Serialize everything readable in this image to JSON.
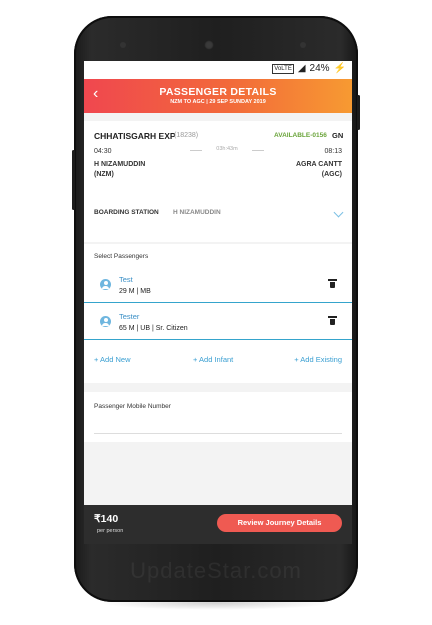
{
  "status_bar": {
    "network": "VoLTE",
    "battery": "24%"
  },
  "header": {
    "title": "PASSENGER DETAILS",
    "subtitle": "NZM TO AGC | 29 SEP SUNDAY 2019"
  },
  "train": {
    "name": "CHHATISGARH EXP",
    "number": "(18238)",
    "availability": "AVAILABLE-0156",
    "class": "GN",
    "dep_time": "04:30",
    "arr_time": "08:13",
    "duration": "03h:43m",
    "from_name": "H NIZAMUDDIN",
    "from_code": "(NZM)",
    "to_name": "AGRA CANTT",
    "to_code": "(AGC)"
  },
  "boarding": {
    "label": "BOARDING STATION",
    "value": "H NIZAMUDDIN"
  },
  "passengers": {
    "title": "Select Passengers",
    "list": [
      {
        "name": "Test",
        "info": "29 M | MB"
      },
      {
        "name": "Tester",
        "info": "65 M | UB | Sr. Citizen"
      }
    ],
    "add_new": "+ Add New",
    "add_infant": "+ Add Infant",
    "add_existing": "+ Add Existing"
  },
  "mobile": {
    "label": "Passenger Mobile Number"
  },
  "footer": {
    "price": "₹140",
    "per": "per person",
    "button": "Review Journey Details"
  },
  "watermark": "UpdateStar.com",
  "colors": {
    "accent": "#3a9fd2",
    "header_start": "#f0474f",
    "header_end": "#f79a32",
    "button": "#ef5a52",
    "available": "#6aa43a"
  },
  "icons": [
    "back-arrow-icon",
    "chevron-down-icon",
    "person-icon",
    "trash-icon"
  ]
}
